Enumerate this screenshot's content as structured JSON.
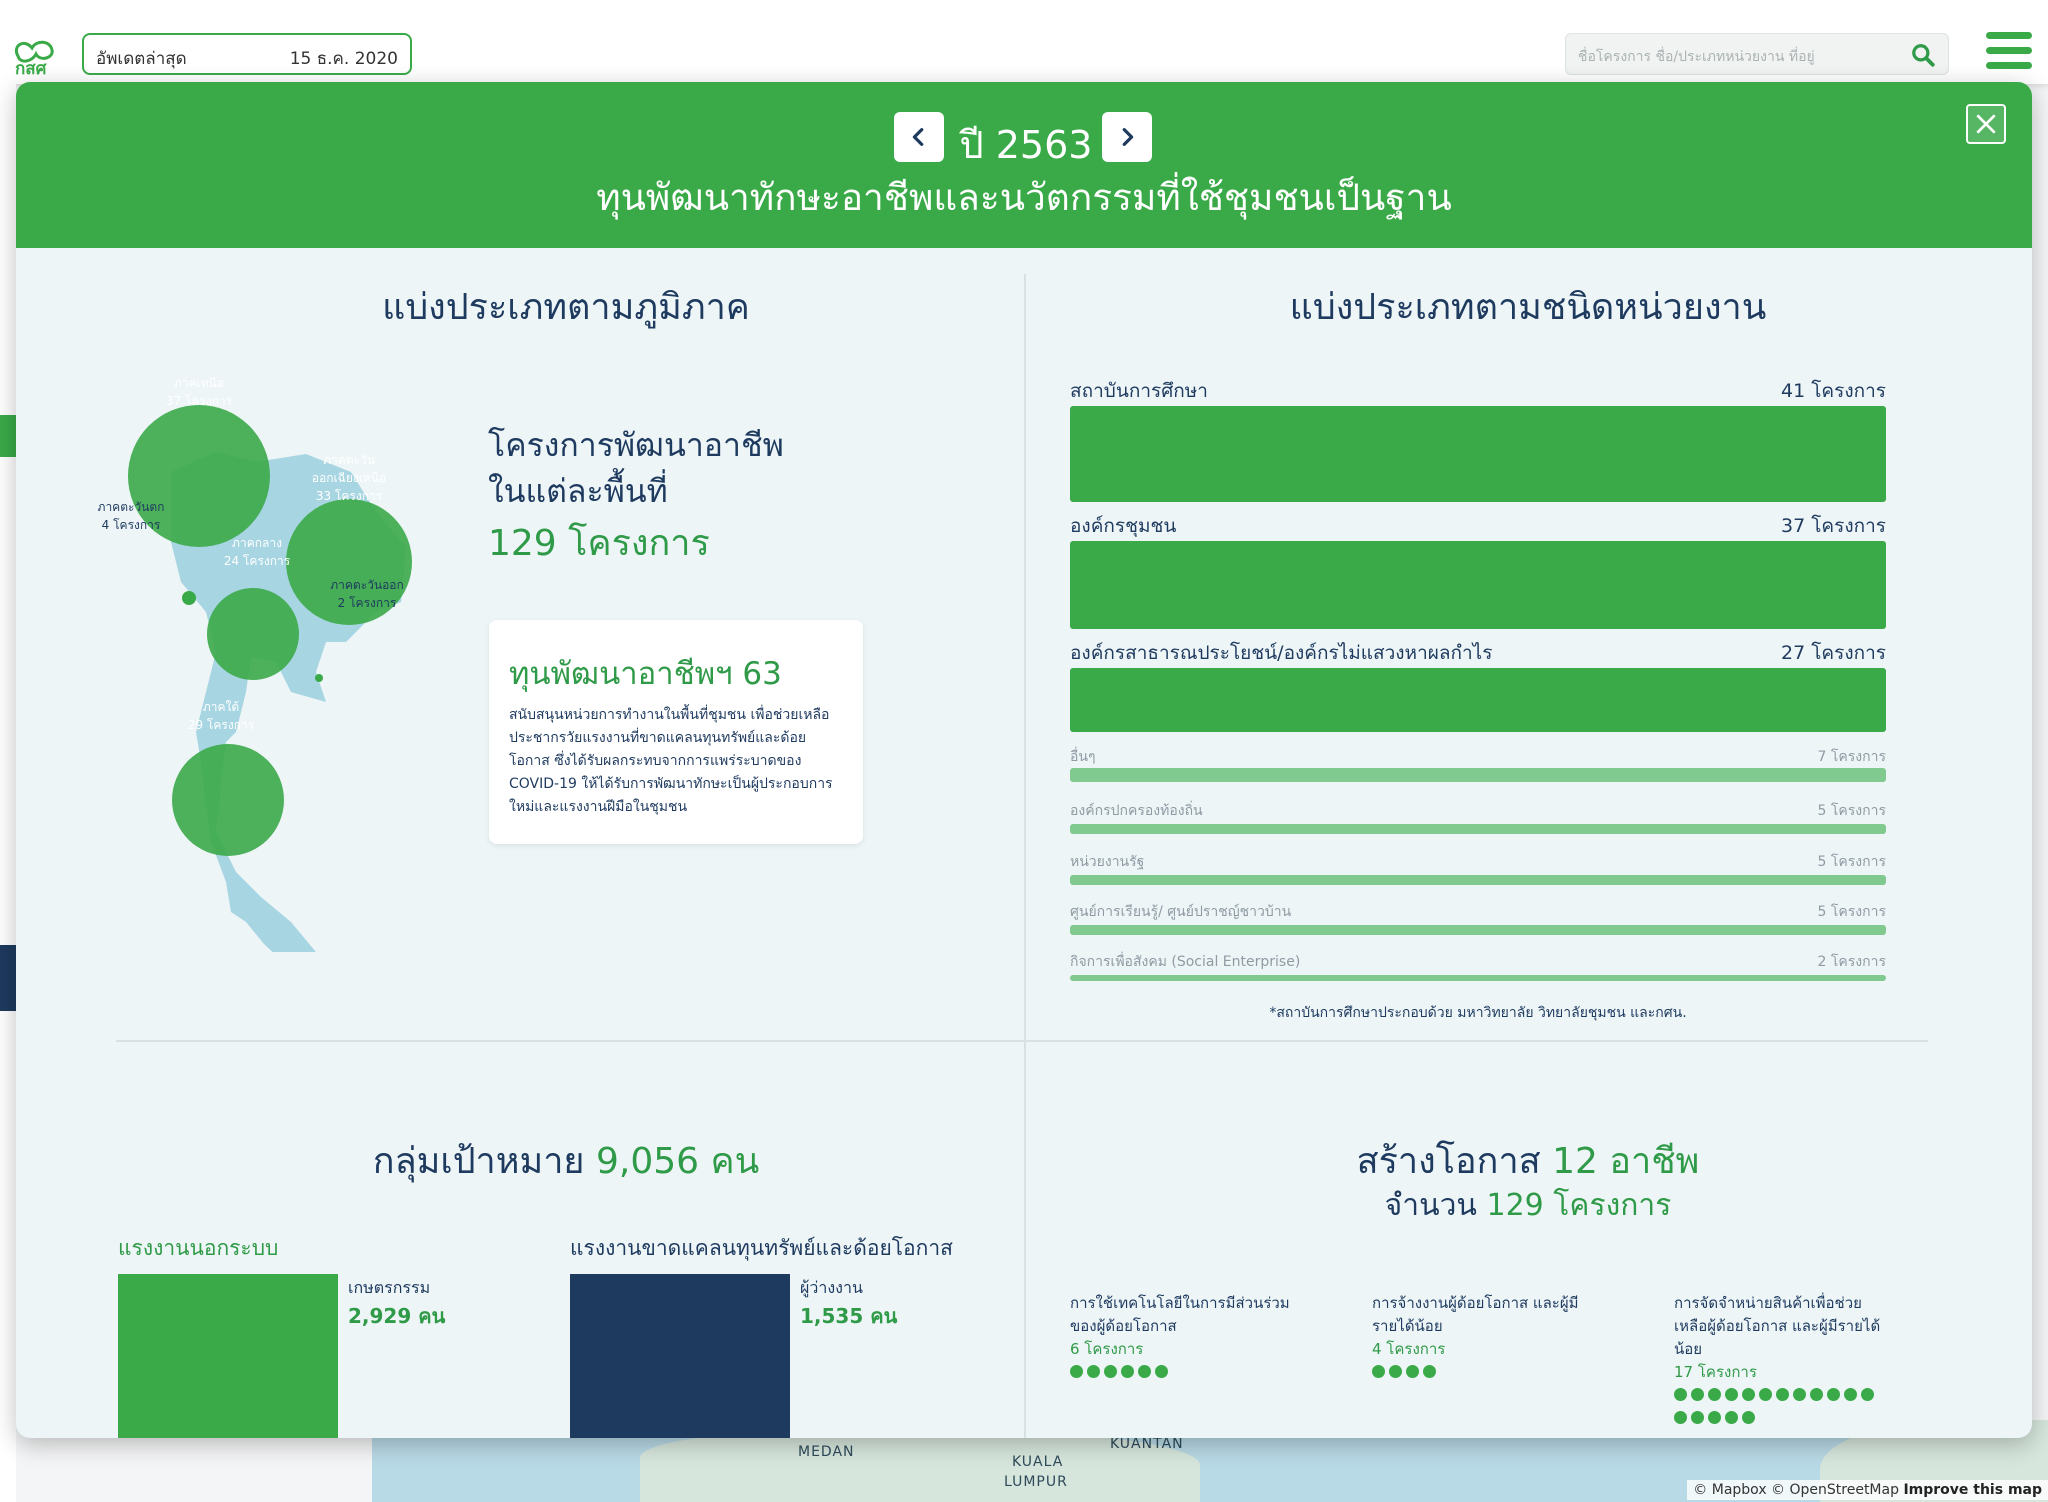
{
  "header": {
    "logo_text": "กสศ",
    "update_label": "อัพเดตล่าสุด",
    "update_date": "15 ธ.ค. 2020",
    "search_placeholder": "ชื่อโครงการ ชื่อ/ประเภทหน่วยงาน ที่อยู่"
  },
  "modal": {
    "year_label": "ปี 2563",
    "fund_title": "ทุนพัฒนาทักษะอาชีพและนวัตกรรมที่ใช้ชุมชนเป็นฐาน"
  },
  "regions": {
    "title": "แบ่งประเภทตามภูมิภาค",
    "heading_line1": "โครงการพัฒนาอาชีพ",
    "heading_line2": "ในแต่ละพื้นที่",
    "total_label": "129 โครงการ",
    "items": [
      {
        "name": "ภาคเหนือ",
        "count_label": "37 โครงการ",
        "projects": 37
      },
      {
        "name": "ภาคตะวัน",
        "name2": "ออกเฉียงเหนือ",
        "count_label": "33 โครงการ",
        "projects": 33
      },
      {
        "name": "ภาคตะวันตก",
        "count_label": "4 โครงการ",
        "projects": 4
      },
      {
        "name": "ภาคกลาง",
        "count_label": "24 โครงการ",
        "projects": 24
      },
      {
        "name": "ภาคตะวันออก",
        "count_label": "2 โครงการ",
        "projects": 2
      },
      {
        "name": "ภาคใต้",
        "count_label": "29 โครงการ",
        "projects": 29
      }
    ],
    "card": {
      "title": "ทุนพัฒนาอาชีพฯ 63",
      "body": "สนับสนุนหน่วยการทำงานในพื้นที่ชุมชน เพื่อช่วยเหลือประชากรวัยแรงงานที่ขาดแคลนทุนทรัพย์และด้อยโอกาส ซึ่งได้รับผลกระทบจากการแพร่ระบาดของ COVID-19 ให้ได้รับการพัฒนาทักษะเป็นผู้ประกอบการใหม่และแรงงานฝีมือในชุมชน"
    }
  },
  "organizations": {
    "title": "แบ่งประเภทตามชนิดหน่วยงาน",
    "max": 41,
    "items": [
      {
        "label": "สถาบันการศึกษา",
        "value_label": "41 โครงการ",
        "value": 41
      },
      {
        "label": "องค์กรชุมชน",
        "value_label": "37 โครงการ",
        "value": 37
      },
      {
        "label": "องค์กรสาธารณประโยชน์/องค์กรไม่แสวงหาผลกำไร",
        "value_label": "27 โครงการ",
        "value": 27
      },
      {
        "label": "อื่นๆ",
        "value_label": "7 โครงการ",
        "value": 7
      },
      {
        "label": "องค์กรปกครองท้องถิ่น",
        "value_label": "5 โครงการ",
        "value": 5
      },
      {
        "label": "หน่วยงานรัฐ",
        "value_label": "5 โครงการ",
        "value": 5
      },
      {
        "label": "ศูนย์การเรียนรู้/ ศูนย์ปราชญ์ชาวบ้าน",
        "value_label": "5 โครงการ",
        "value": 5
      },
      {
        "label": "กิจการเพื่อสังคม (Social Enterprise)",
        "value_label": "2 โครงการ",
        "value": 2
      }
    ],
    "note": "*สถาบันการศึกษาประกอบด้วย มหาวิทยาลัย วิทยาลัยชุมชน และกศน."
  },
  "target": {
    "title_prefix": "กลุ่มเป้าหมาย",
    "title_value": "9,056 คน",
    "groups": [
      {
        "label": "แรงงานนอกระบบ",
        "category": "เกษตรกรรม",
        "value_label": "2,929 คน",
        "color": "#3aaa48"
      },
      {
        "label": "แรงงานขาดแคลนทุนทรัพย์และด้อยโอกาส",
        "category": "ผู้ว่างงาน",
        "value_label": "1,535 คน",
        "color": "#1e3a5f"
      }
    ]
  },
  "careers": {
    "title_prefix": "สร้างโอกาส",
    "title_value": "12 อาชีพ",
    "sub_prefix": "จำนวน",
    "sub_value": "129 โครงการ",
    "items": [
      {
        "name": "การใช้เทคโนโลยีในการมีส่วนร่วมของผู้ด้อยโอกาส",
        "count_label": "6 โครงการ",
        "count": 6
      },
      {
        "name": "การจ้างงานผู้ด้อยโอกาส และผู้มีรายได้น้อย",
        "count_label": "4 โครงการ",
        "count": 4
      },
      {
        "name": "การจัดจำหน่ายสินค้าเพื่อช่วยเหลือผู้ด้อยโอกาส และผู้มีรายได้น้อย",
        "count_label": "17 โครงการ",
        "count": 17
      }
    ]
  },
  "map": {
    "labels": [
      "MEDAN",
      "KUALA",
      "LUMPUR",
      "KUANTAN"
    ],
    "attribution": "© Mapbox © OpenStreetMap",
    "improve": "Improve this map"
  },
  "colors": {
    "brand_green": "#3aaa48",
    "navy": "#1e3a5f",
    "light_green": "#80c98f",
    "modal_bg": "#edf5f7"
  }
}
